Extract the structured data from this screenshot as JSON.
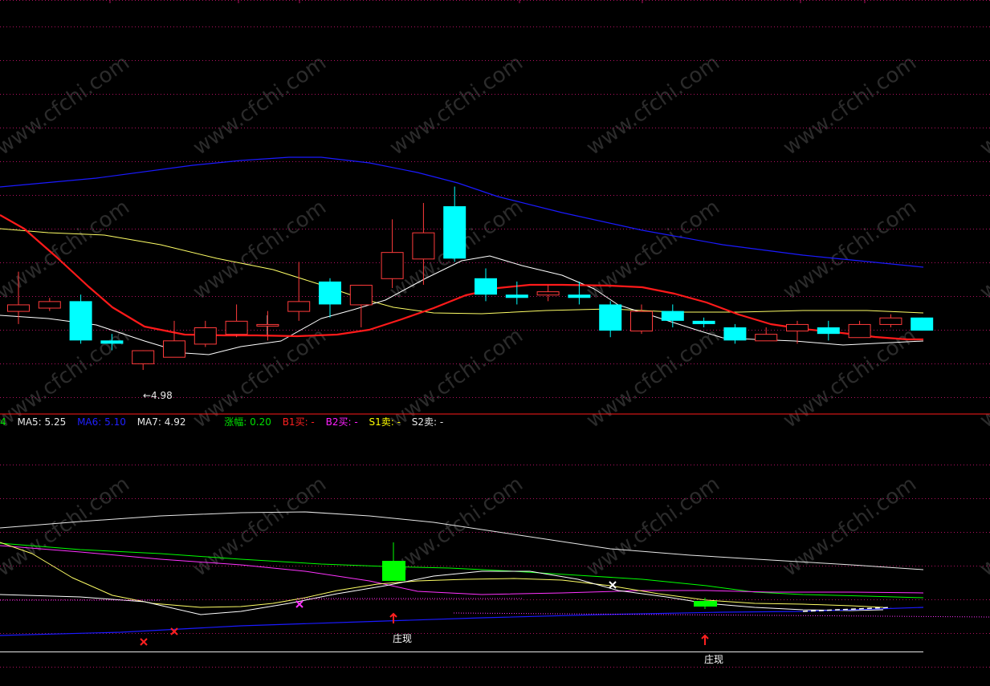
{
  "watermark": "www.cfchi.com",
  "chart_data": {
    "type": "candlestick",
    "price_axis": {
      "min": 4.8,
      "max": 6.05
    },
    "candles": [
      {
        "o": 5.12,
        "h": 5.22,
        "l": 5.06,
        "c": 5.1,
        "dir": "up"
      },
      {
        "o": 5.11,
        "h": 5.14,
        "l": 5.1,
        "c": 5.13,
        "dir": "up"
      },
      {
        "o": 5.13,
        "h": 5.15,
        "l": 5.0,
        "c": 5.01,
        "dir": "down"
      },
      {
        "o": 5.01,
        "h": 5.03,
        "l": 4.98,
        "c": 5.0,
        "dir": "down"
      },
      {
        "o": 4.94,
        "h": 4.98,
        "l": 4.92,
        "c": 4.98,
        "dir": "up"
      },
      {
        "o": 4.96,
        "h": 5.07,
        "l": 4.96,
        "c": 5.01,
        "dir": "up"
      },
      {
        "o": 5.0,
        "h": 5.07,
        "l": 4.99,
        "c": 5.05,
        "dir": "up"
      },
      {
        "o": 5.03,
        "h": 5.12,
        "l": 5.02,
        "c": 5.07,
        "dir": "up"
      },
      {
        "o": 5.06,
        "h": 5.1,
        "l": 5.01,
        "c": 5.06,
        "dir": "up"
      },
      {
        "o": 5.1,
        "h": 5.25,
        "l": 5.07,
        "c": 5.13,
        "dir": "up"
      },
      {
        "o": 5.19,
        "h": 5.2,
        "l": 5.08,
        "c": 5.12,
        "dir": "down"
      },
      {
        "o": 5.12,
        "h": 5.18,
        "l": 5.05,
        "c": 5.18,
        "dir": "up"
      },
      {
        "o": 5.2,
        "h": 5.38,
        "l": 5.17,
        "c": 5.28,
        "dir": "up"
      },
      {
        "o": 5.26,
        "h": 5.43,
        "l": 5.18,
        "c": 5.34,
        "dir": "up"
      },
      {
        "o": 5.42,
        "h": 5.48,
        "l": 5.25,
        "c": 5.26,
        "dir": "down"
      },
      {
        "o": 5.2,
        "h": 5.23,
        "l": 5.13,
        "c": 5.15,
        "dir": "down"
      },
      {
        "o": 5.15,
        "h": 5.19,
        "l": 5.12,
        "c": 5.14,
        "dir": "down"
      },
      {
        "o": 5.15,
        "h": 5.18,
        "l": 5.13,
        "c": 5.16,
        "dir": "up"
      },
      {
        "o": 5.15,
        "h": 5.19,
        "l": 5.12,
        "c": 5.14,
        "dir": "down"
      },
      {
        "o": 5.12,
        "h": 5.13,
        "l": 5.02,
        "c": 5.04,
        "dir": "down"
      },
      {
        "o": 5.04,
        "h": 5.12,
        "l": 5.03,
        "c": 5.1,
        "dir": "up"
      },
      {
        "o": 5.1,
        "h": 5.12,
        "l": 5.05,
        "c": 5.07,
        "dir": "down"
      },
      {
        "o": 5.07,
        "h": 5.08,
        "l": 5.05,
        "c": 5.06,
        "dir": "down"
      },
      {
        "o": 5.05,
        "h": 5.06,
        "l": 5.0,
        "c": 5.01,
        "dir": "down"
      },
      {
        "o": 5.01,
        "h": 5.05,
        "l": 5.01,
        "c": 5.03,
        "dir": "up"
      },
      {
        "o": 5.04,
        "h": 5.07,
        "l": 5.0,
        "c": 5.06,
        "dir": "up"
      },
      {
        "o": 5.05,
        "h": 5.07,
        "l": 5.01,
        "c": 5.03,
        "dir": "down"
      },
      {
        "o": 5.02,
        "h": 5.07,
        "l": 5.02,
        "c": 5.06,
        "dir": "up"
      },
      {
        "o": 5.06,
        "h": 5.09,
        "l": 5.05,
        "c": 5.08,
        "dir": "up"
      },
      {
        "o": 5.08,
        "h": 5.08,
        "l": 5.04,
        "c": 5.04,
        "dir": "down"
      }
    ],
    "low_label": "←4.98",
    "legend": [
      {
        "text": "4",
        "color": "#00e000"
      },
      {
        "text": "MA5: 5.25",
        "color": "#e8e8e8"
      },
      {
        "text": "MA6: 5.10",
        "color": "#2020ff"
      },
      {
        "text": "MA7: 4.92",
        "color": "#e8e8e8"
      },
      {
        "text": "涨幅: 0.20",
        "color": "#00e000"
      },
      {
        "text": "B1买: -",
        "color": "#ff2020"
      },
      {
        "text": "B2买: -",
        "color": "#ff20ff"
      },
      {
        "text": "S1卖: -",
        "color": "#ffff00"
      },
      {
        "text": "S2卖: -",
        "color": "#e8e8e8"
      }
    ],
    "lower_annotations": [
      "庄现",
      "庄现"
    ],
    "colors": {
      "up": "#ff3b3b",
      "down": "#00ffff",
      "ma_red": "#ff1a1a",
      "ma_blue": "#1a1aff",
      "ma_yellow": "#ffff66",
      "ma_white": "#ffffff",
      "grid": "#b01060",
      "green": "#00ff00",
      "magenta": "#ff33ff"
    }
  }
}
